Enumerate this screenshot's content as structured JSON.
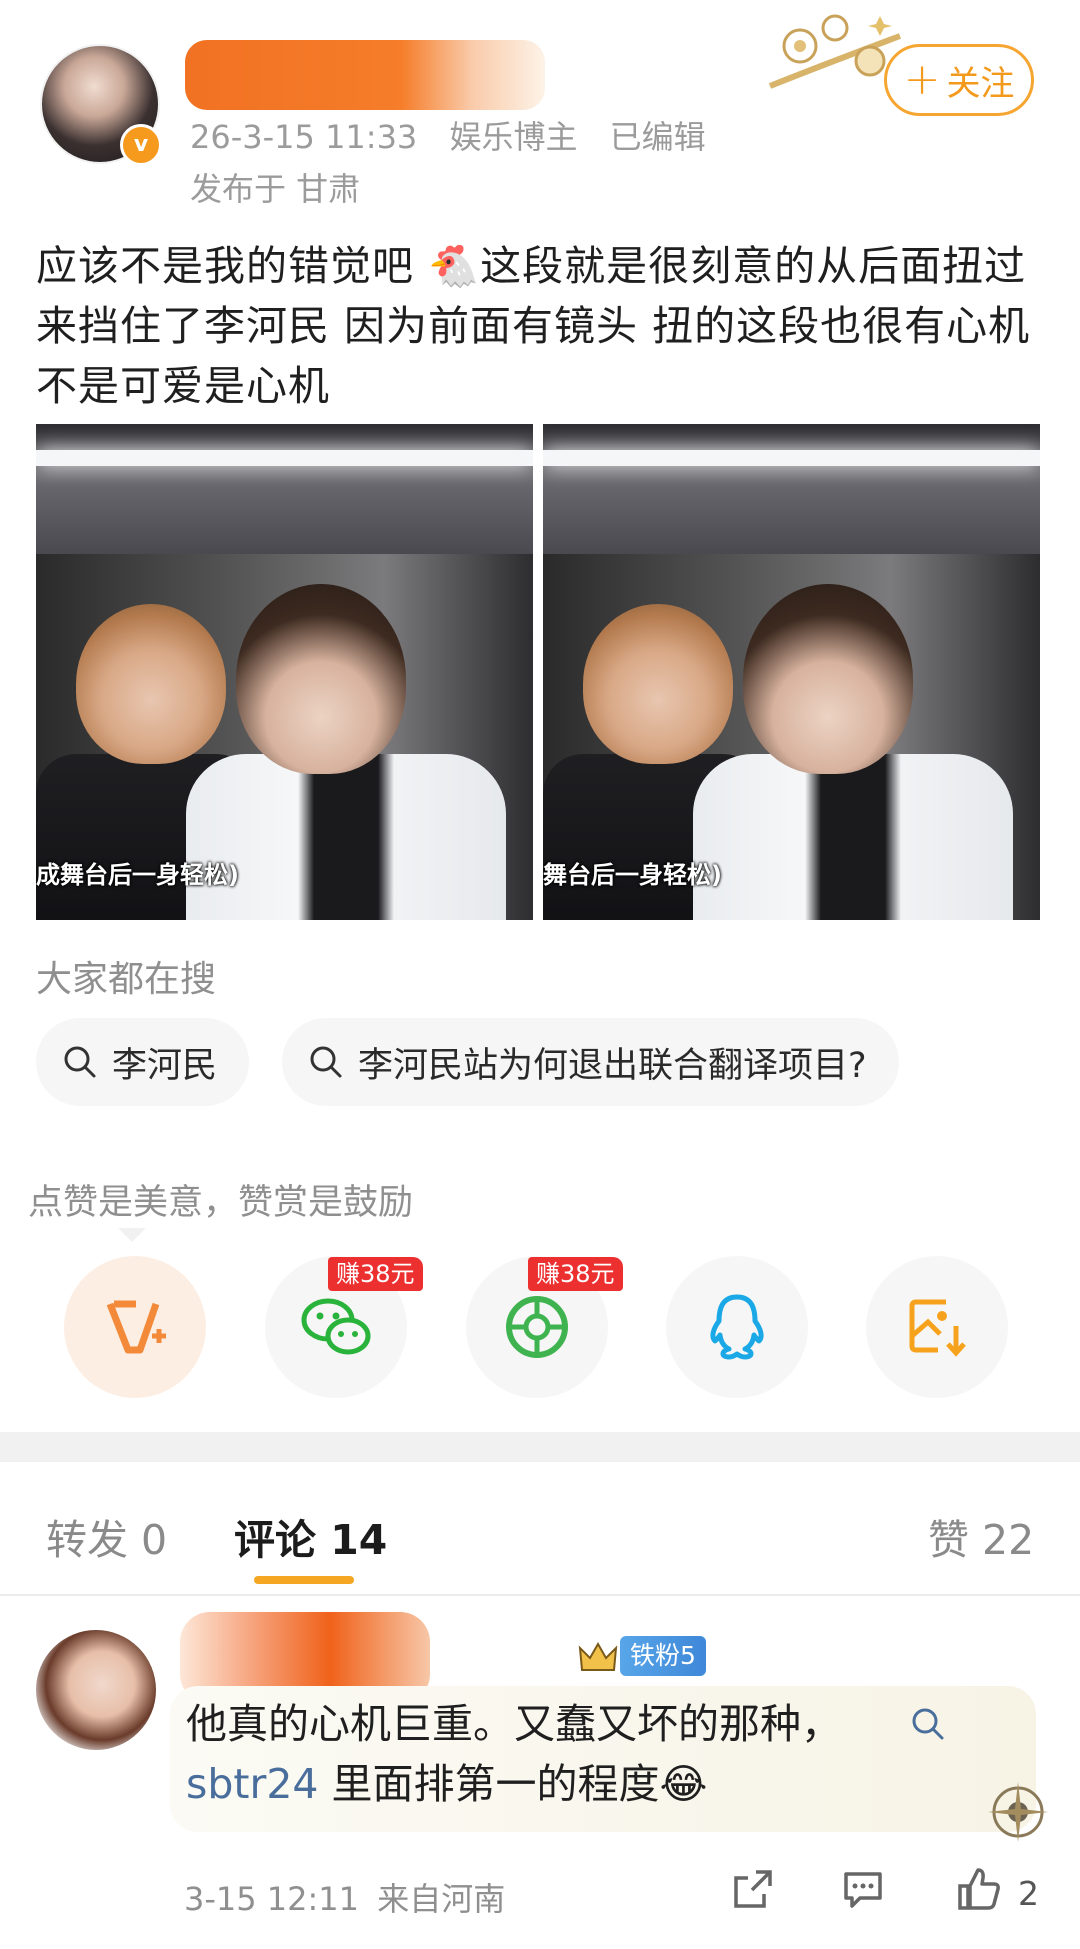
{
  "post": {
    "meta_time": "26-3-15 11:33",
    "meta_role": "娱乐博主",
    "meta_edited": "已编辑",
    "location": "发布于 甘肃",
    "follow_label": "关注",
    "text_before_emoji": "应该不是我的错觉吧 ",
    "emoji": "🐔",
    "text_after_emoji": "这段就是很刻意的从后面扭过来挡住了李河民 因为前面有镜头 扭的这段也很有心机不是可爱是心机",
    "photos": [
      {
        "caption": "成舞台后一身轻松)"
      },
      {
        "caption": "舞台后一身轻松)"
      }
    ]
  },
  "search": {
    "title": "大家都在搜",
    "chips": [
      "李河民",
      "李河民站为何退出联合翻译项目?"
    ]
  },
  "reward": {
    "title": "点赞是美意，赞赏是鼓励",
    "earn_badge": "赚38元",
    "share_icons": [
      "reward-v-icon",
      "wechat-icon",
      "moments-icon",
      "qq-icon",
      "save-image-icon"
    ]
  },
  "tabs": {
    "repost": "转发 0",
    "comments": "评论 14",
    "likes": "赞 22"
  },
  "comment": {
    "fan_badge": "铁粉5",
    "text": "他真的心机巨重。又蠢又坏的那种，",
    "topic": "sbtr24",
    "text_tail": " 里面排第一的程度",
    "tail_emoji": "😂",
    "time": "3-15 12:11",
    "location": "来自河南",
    "like_count": "2"
  },
  "colors": {
    "accent": "#f39a1d",
    "earn_red": "#ec2f2f",
    "wechat_green": "#29b33b",
    "qq_blue": "#1ba8e6",
    "topic_blue": "#4a6e9c"
  }
}
